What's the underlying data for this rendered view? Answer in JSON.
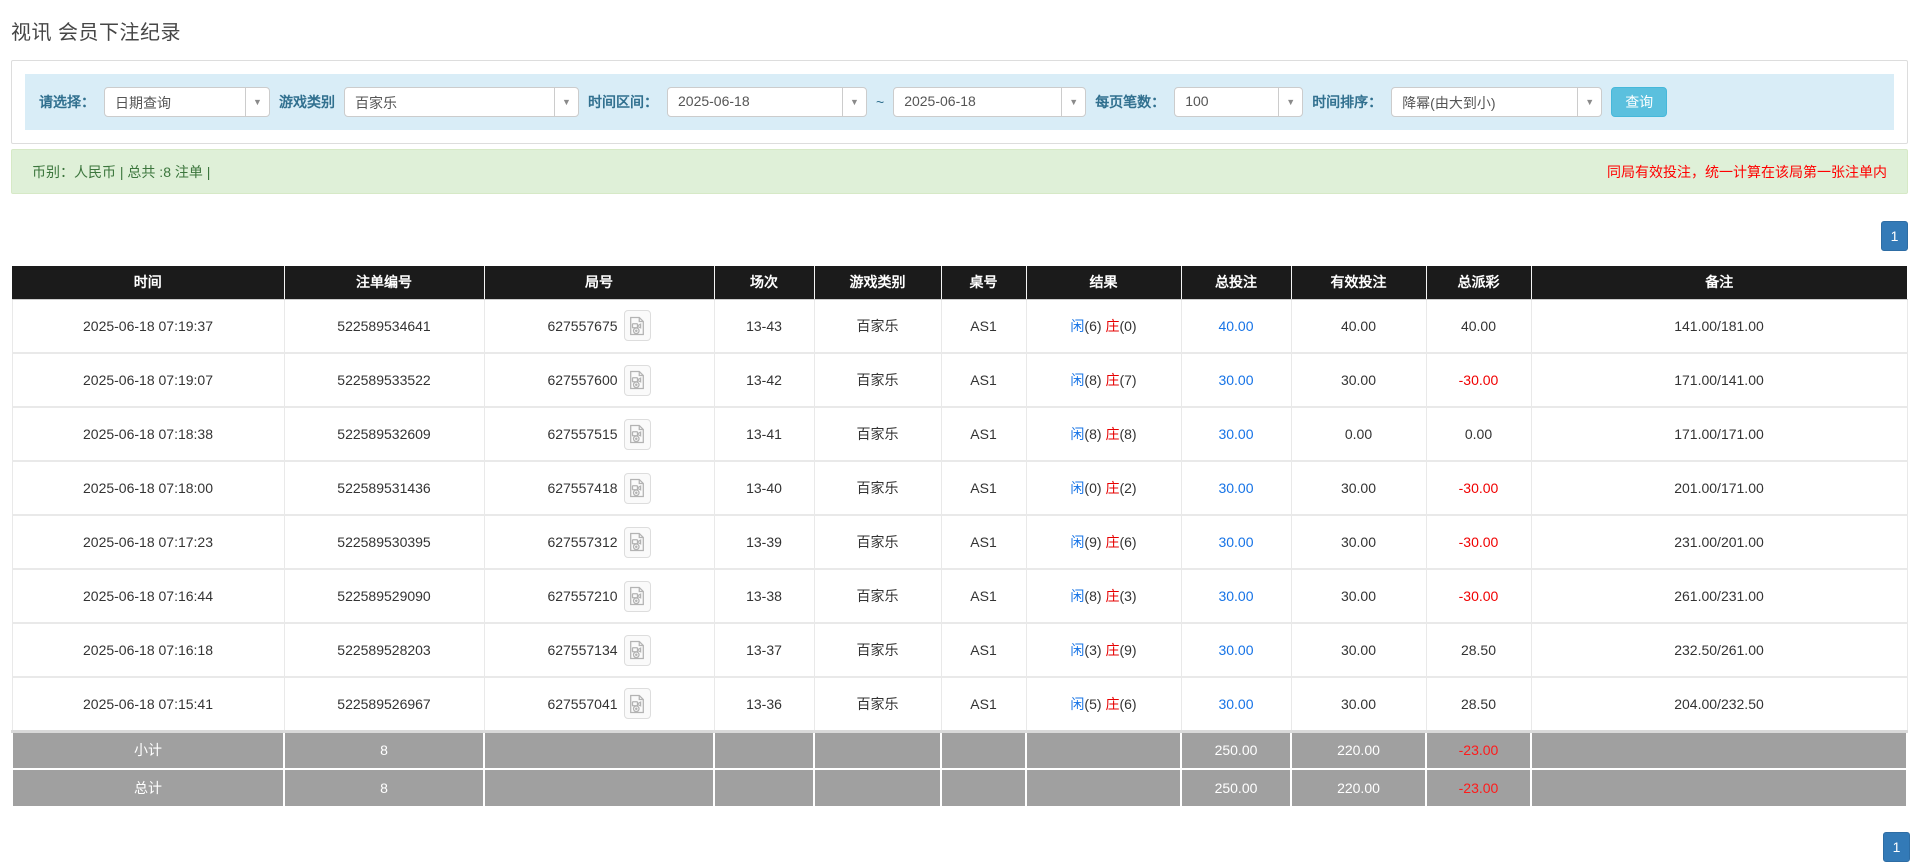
{
  "page": {
    "title": "视讯 会员下注纪录"
  },
  "filters": {
    "select_label": "请选择：",
    "select_value": "日期查询",
    "game_type_label": "游戏类别",
    "game_type_value": "百家乐",
    "time_range_label": "时间区间：",
    "date_from": "2025-06-18",
    "tilde": "~",
    "date_to": "2025-06-18",
    "page_size_label": "每页笔数：",
    "page_size_value": "100",
    "sort_label": "时间排序：",
    "sort_value": "降幂(由大到小)",
    "search_button": "查询"
  },
  "summary": {
    "left": "币别：人民币 | 总共 :8 注单 |",
    "right_note": "同局有效投注，统一计算在该局第一张注单内"
  },
  "pagination": {
    "page": "1"
  },
  "table": {
    "headers": [
      "时间",
      "注单编号",
      "局号",
      "场次",
      "游戏类别",
      "桌号",
      "结果",
      "总投注",
      "有效投注",
      "总派彩",
      "备注"
    ],
    "rows": [
      {
        "time": "2025-06-18 07:19:37",
        "bet_id": "522589534641",
        "round_id": "627557675",
        "session": "13-43",
        "game": "百家乐",
        "table_no": "AS1",
        "player_label": "闲",
        "player_score": "(6)",
        "banker_label": "庄",
        "banker_score": "(0)",
        "total_bet": "40.00",
        "valid_bet": "40.00",
        "payout": "40.00",
        "payout_negative": false,
        "note": "141.00/181.00"
      },
      {
        "time": "2025-06-18 07:19:07",
        "bet_id": "522589533522",
        "round_id": "627557600",
        "session": "13-42",
        "game": "百家乐",
        "table_no": "AS1",
        "player_label": "闲",
        "player_score": "(8)",
        "banker_label": "庄",
        "banker_score": "(7)",
        "total_bet": "30.00",
        "valid_bet": "30.00",
        "payout": "-30.00",
        "payout_negative": true,
        "note": "171.00/141.00"
      },
      {
        "time": "2025-06-18 07:18:38",
        "bet_id": "522589532609",
        "round_id": "627557515",
        "session": "13-41",
        "game": "百家乐",
        "table_no": "AS1",
        "player_label": "闲",
        "player_score": "(8)",
        "banker_label": "庄",
        "banker_score": "(8)",
        "total_bet": "30.00",
        "valid_bet": "0.00",
        "payout": "0.00",
        "payout_negative": false,
        "note": "171.00/171.00"
      },
      {
        "time": "2025-06-18 07:18:00",
        "bet_id": "522589531436",
        "round_id": "627557418",
        "session": "13-40",
        "game": "百家乐",
        "table_no": "AS1",
        "player_label": "闲",
        "player_score": "(0)",
        "banker_label": "庄",
        "banker_score": "(2)",
        "total_bet": "30.00",
        "valid_bet": "30.00",
        "payout": "-30.00",
        "payout_negative": true,
        "note": "201.00/171.00"
      },
      {
        "time": "2025-06-18 07:17:23",
        "bet_id": "522589530395",
        "round_id": "627557312",
        "session": "13-39",
        "game": "百家乐",
        "table_no": "AS1",
        "player_label": "闲",
        "player_score": "(9)",
        "banker_label": "庄",
        "banker_score": "(6)",
        "total_bet": "30.00",
        "valid_bet": "30.00",
        "payout": "-30.00",
        "payout_negative": true,
        "note": "231.00/201.00"
      },
      {
        "time": "2025-06-18 07:16:44",
        "bet_id": "522589529090",
        "round_id": "627557210",
        "session": "13-38",
        "game": "百家乐",
        "table_no": "AS1",
        "player_label": "闲",
        "player_score": "(8)",
        "banker_label": "庄",
        "banker_score": "(3)",
        "total_bet": "30.00",
        "valid_bet": "30.00",
        "payout": "-30.00",
        "payout_negative": true,
        "note": "261.00/231.00"
      },
      {
        "time": "2025-06-18 07:16:18",
        "bet_id": "522589528203",
        "round_id": "627557134",
        "session": "13-37",
        "game": "百家乐",
        "table_no": "AS1",
        "player_label": "闲",
        "player_score": "(3)",
        "banker_label": "庄",
        "banker_score": "(9)",
        "total_bet": "30.00",
        "valid_bet": "30.00",
        "payout": "28.50",
        "payout_negative": false,
        "note": "232.50/261.00"
      },
      {
        "time": "2025-06-18 07:15:41",
        "bet_id": "522589526967",
        "round_id": "627557041",
        "session": "13-36",
        "game": "百家乐",
        "table_no": "AS1",
        "player_label": "闲",
        "player_score": "(5)",
        "banker_label": "庄",
        "banker_score": "(6)",
        "total_bet": "30.00",
        "valid_bet": "30.00",
        "payout": "28.50",
        "payout_negative": false,
        "note": "204.00/232.50"
      }
    ],
    "subtotal": {
      "label": "小计",
      "count": "8",
      "total_bet": "250.00",
      "valid_bet": "220.00",
      "payout": "-23.00",
      "payout_negative": true
    },
    "total": {
      "label": "总计",
      "count": "8",
      "total_bet": "250.00",
      "valid_bet": "220.00",
      "payout": "-23.00",
      "payout_negative": true
    }
  },
  "icons": {
    "video_record": "video-file-icon",
    "dropdown": "chevron-down-icon"
  },
  "colors": {
    "filter_bar_bg": "#d9edf7",
    "filter_label": "#31708f",
    "search_btn": "#5bc0de",
    "success_bg": "#dff0d8",
    "success_text": "#3c763d",
    "warning_text": "#ff0000",
    "header_bg": "#1b1b1b",
    "footer_bg": "#a0a0a0",
    "link_blue": "#1673e6",
    "player_blue": "#1673e6",
    "banker_red": "#e60000",
    "negative_red": "#f00000",
    "pager_blue": "#337ab7"
  }
}
